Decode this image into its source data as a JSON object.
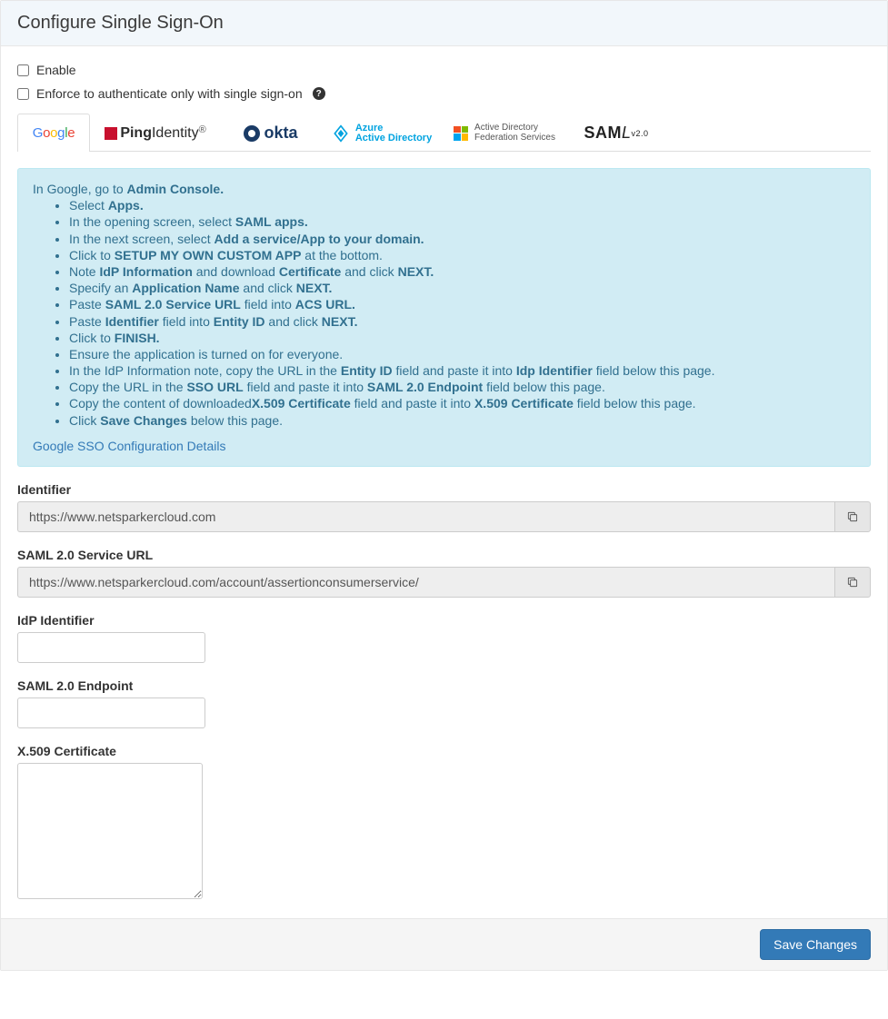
{
  "header": {
    "title": "Configure Single Sign-On"
  },
  "checkboxes": {
    "enable": {
      "label": "Enable",
      "checked": false
    },
    "enforce": {
      "label": "Enforce to authenticate only with single sign-on",
      "checked": false
    }
  },
  "tabs": {
    "google": "Google",
    "ping": {
      "brand": "Ping",
      "suffix": "Identity"
    },
    "okta": "okta",
    "azure": {
      "line1": "Azure",
      "line2": "Active Directory"
    },
    "adfs": {
      "line1": "Active Directory",
      "line2": "Federation Services"
    },
    "saml": {
      "brand": "SAML",
      "version": "v2.0"
    }
  },
  "instructions": {
    "intro_pre": "In Google, go to ",
    "intro_strong": "Admin Console.",
    "items": [
      {
        "pre": "Select ",
        "strong": "Apps."
      },
      {
        "pre": "In the opening screen, select ",
        "strong": "SAML apps."
      },
      {
        "pre": "In the next screen, select ",
        "strong": "Add a service/App to your domain."
      },
      {
        "pre": "Click to ",
        "strong": "SETUP MY OWN CUSTOM APP",
        "post": " at the bottom."
      },
      {
        "pre": "Note ",
        "strong": "IdP Information",
        "mid": " and download ",
        "strong2": "Certificate",
        "mid2": " and click ",
        "strong3": "NEXT."
      },
      {
        "pre": "Specify an ",
        "strong": "Application Name",
        "mid": " and click ",
        "strong2": "NEXT."
      },
      {
        "pre": "Paste ",
        "strong": "SAML 2.0 Service URL",
        "mid": " field into ",
        "strong2": "ACS URL."
      },
      {
        "pre": "Paste ",
        "strong": "Identifier",
        "mid": " field into ",
        "strong2": "Entity ID",
        "mid2": " and click ",
        "strong3": "NEXT."
      },
      {
        "pre": "Click to ",
        "strong": "FINISH."
      },
      {
        "pre": "Ensure the application is turned on for everyone."
      },
      {
        "pre": "In the IdP Information note, copy the URL in the ",
        "strong": "Entity ID",
        "mid": " field and paste it into ",
        "strong2": "Idp Identifier",
        "post": " field below this page."
      },
      {
        "pre": "Copy the URL in the ",
        "strong": "SSO URL",
        "mid": " field and paste it into ",
        "strong2": "SAML 2.0 Endpoint",
        "post": " field below this page."
      },
      {
        "pre": "Copy the content of downloaded",
        "strong": "X.509 Certificate",
        "mid": " field and paste it into ",
        "strong2": "X.509 Certificate",
        "post": " field below this page."
      },
      {
        "pre": "Click ",
        "strong": "Save Changes",
        "post": " below this page."
      }
    ],
    "link": "Google SSO Configuration Details"
  },
  "fields": {
    "identifier": {
      "label": "Identifier",
      "value": "https://www.netsparkercloud.com"
    },
    "service_url": {
      "label": "SAML 2.0 Service URL",
      "value": "https://www.netsparkercloud.com/account/assertionconsumerservice/"
    },
    "idp_identifier": {
      "label": "IdP Identifier",
      "value": ""
    },
    "endpoint": {
      "label": "SAML 2.0 Endpoint",
      "value": ""
    },
    "cert": {
      "label": "X.509 Certificate",
      "value": ""
    }
  },
  "footer": {
    "save": "Save Changes"
  }
}
